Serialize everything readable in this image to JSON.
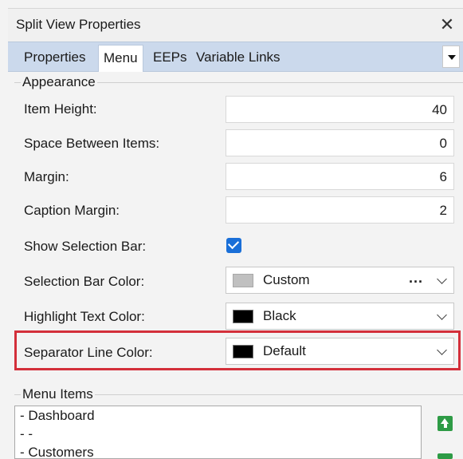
{
  "window": {
    "title": "Split View Properties",
    "close_glyph": "✕"
  },
  "tabs": [
    {
      "label": "Properties",
      "active": false
    },
    {
      "label": "Menu",
      "active": true
    },
    {
      "label": "EEPs",
      "active": false
    },
    {
      "label": "Variable Links",
      "active": false
    }
  ],
  "appearance": {
    "group_label": "Appearance",
    "item_height": {
      "label": "Item Height:",
      "value": "40"
    },
    "space_between_items": {
      "label": "Space Between Items:",
      "value": "0"
    },
    "margin": {
      "label": "Margin:",
      "value": "6"
    },
    "caption_margin": {
      "label": "Caption Margin:",
      "value": "2"
    },
    "show_selection_bar": {
      "label": "Show Selection Bar:",
      "checked": true
    },
    "selection_bar_color": {
      "label": "Selection Bar Color:",
      "value": "Custom",
      "swatch": "#c0c0c0",
      "ellipsis": "..."
    },
    "highlight_text_color": {
      "label": "Highlight Text Color:",
      "value": "Black",
      "swatch": "#000000"
    },
    "separator_line_color": {
      "label": "Separator Line Color:",
      "value": "Default",
      "swatch": "#000000"
    }
  },
  "menu_items": {
    "group_label": "Menu Items",
    "items": [
      "- Dashboard",
      "- -",
      "- Customers"
    ]
  },
  "colors": {
    "highlight_border": "#d32f3a",
    "tab_bar": "#cbd9ec",
    "checkbox": "#1a6fd8",
    "move_button": "#2e9b46"
  }
}
